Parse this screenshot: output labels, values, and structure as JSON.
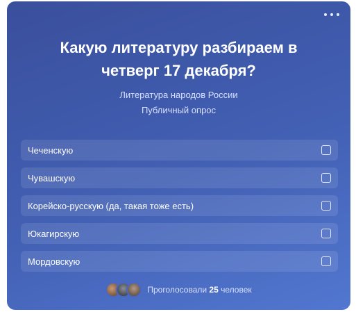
{
  "poll": {
    "question": "Какую литературу разбираем в четверг 17 декабря?",
    "subtitle_line1": "Литература народов России",
    "subtitle_line2": "Публичный опрос",
    "options": [
      {
        "label": "Чеченскую"
      },
      {
        "label": "Чувашскую"
      },
      {
        "label": "Корейско-русскую (да, такая тоже есть)"
      },
      {
        "label": "Юкагирскую"
      },
      {
        "label": "Мордовскую"
      }
    ],
    "footer": {
      "prefix": "Проголосовали",
      "count": "25",
      "suffix": "человек"
    }
  },
  "icons": {
    "menu": "more-horizontal-icon"
  }
}
